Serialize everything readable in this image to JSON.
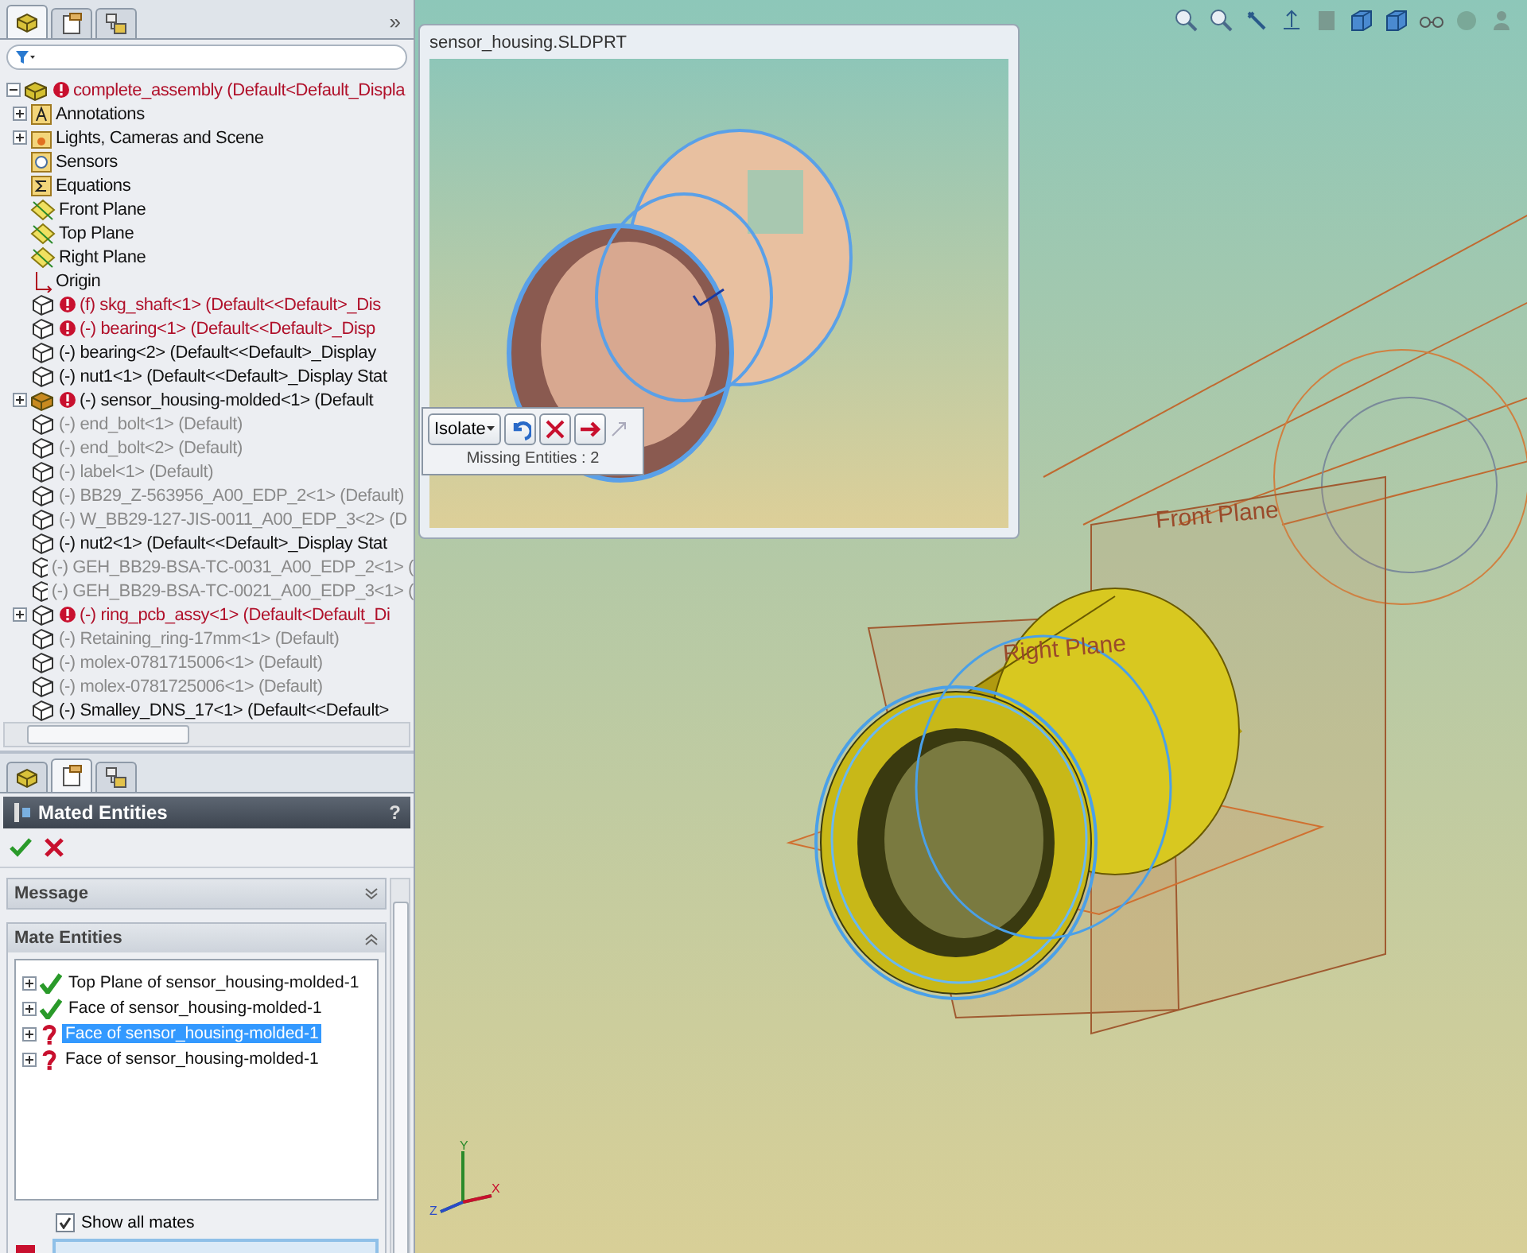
{
  "feature_manager": {
    "tabs": [
      {
        "kind": "tree",
        "selected": true
      },
      {
        "kind": "property",
        "selected": false
      },
      {
        "kind": "config",
        "selected": false
      }
    ],
    "collapse_glyph": "»",
    "tree": {
      "label": "complete_assembly  (Default<Default_Displa",
      "kind": "assembly",
      "failed": true,
      "suppressed": false,
      "error_mark": true,
      "expanded": true,
      "children": [
        {
          "label": "Annotations",
          "kind": "annotations",
          "failed": false,
          "suppressed": false,
          "error_mark": false,
          "expanded": false
        },
        {
          "label": "Lights, Cameras and Scene",
          "kind": "lights",
          "failed": false,
          "suppressed": false,
          "error_mark": false,
          "expanded": false
        },
        {
          "label": "Sensors",
          "kind": "sensors",
          "failed": false,
          "suppressed": false,
          "error_mark": false
        },
        {
          "label": "Equations",
          "kind": "equations",
          "failed": false,
          "suppressed": false,
          "error_mark": false
        },
        {
          "label": "Front Plane",
          "kind": "plane",
          "failed": false,
          "suppressed": false,
          "error_mark": false
        },
        {
          "label": "Top Plane",
          "kind": "plane",
          "failed": false,
          "suppressed": false,
          "error_mark": false
        },
        {
          "label": "Right Plane",
          "kind": "plane",
          "failed": false,
          "suppressed": false,
          "error_mark": false
        },
        {
          "label": "Origin",
          "kind": "origin",
          "failed": false,
          "suppressed": false,
          "error_mark": false
        },
        {
          "label": "(f) skg_shaft<1> (Default<<Default>_Dis",
          "kind": "part",
          "failed": true,
          "suppressed": false,
          "error_mark": true
        },
        {
          "label": "(-) bearing<1> (Default<<Default>_Disp",
          "kind": "part",
          "failed": true,
          "suppressed": false,
          "error_mark": true
        },
        {
          "label": "(-) bearing<2> (Default<<Default>_Display",
          "kind": "part",
          "failed": false,
          "suppressed": false,
          "error_mark": false
        },
        {
          "label": "(-) nut1<1> (Default<<Default>_Display Stat",
          "kind": "part",
          "failed": false,
          "suppressed": false,
          "error_mark": false
        },
        {
          "label": "(-) sensor_housing-molded<1> (Default",
          "kind": "subassembly",
          "failed": false,
          "suppressed": false,
          "error_mark": true,
          "expanded": false
        },
        {
          "label": "(-) end_bolt<1> (Default)",
          "kind": "part",
          "failed": false,
          "suppressed": true,
          "error_mark": false
        },
        {
          "label": "(-) end_bolt<2> (Default)",
          "kind": "part",
          "failed": false,
          "suppressed": true,
          "error_mark": false
        },
        {
          "label": "(-) label<1> (Default)",
          "kind": "part",
          "failed": false,
          "suppressed": true,
          "error_mark": false
        },
        {
          "label": "(-) BB29_Z-563956_A00_EDP_2<1> (Default)",
          "kind": "part",
          "failed": false,
          "suppressed": true,
          "error_mark": false
        },
        {
          "label": "(-) W_BB29-127-JIS-0011_A00_EDP_3<2> (D",
          "kind": "part",
          "failed": false,
          "suppressed": true,
          "error_mark": false
        },
        {
          "label": "(-) nut2<1> (Default<<Default>_Display Stat",
          "kind": "part",
          "failed": false,
          "suppressed": false,
          "error_mark": false
        },
        {
          "label": "(-) GEH_BB29-BSA-TC-0031_A00_EDP_2<1> (",
          "kind": "part",
          "failed": false,
          "suppressed": true,
          "error_mark": false
        },
        {
          "label": "(-) GEH_BB29-BSA-TC-0021_A00_EDP_3<1> (",
          "kind": "part",
          "failed": false,
          "suppressed": true,
          "error_mark": false
        },
        {
          "label": "(-) ring_pcb_assy<1> (Default<Default_Di",
          "kind": "part",
          "failed": true,
          "suppressed": false,
          "error_mark": true,
          "expanded": false
        },
        {
          "label": "(-) Retaining_ring-17mm<1> (Default)",
          "kind": "part",
          "failed": false,
          "suppressed": true,
          "error_mark": false
        },
        {
          "label": "(-) molex-0781715006<1> (Default)",
          "kind": "part",
          "failed": false,
          "suppressed": true,
          "error_mark": false
        },
        {
          "label": "(-) molex-0781725006<1> (Default)",
          "kind": "part",
          "failed": false,
          "suppressed": true,
          "error_mark": false
        },
        {
          "label": "(-) Smalley_DNS_17<1> (Default<<Default>",
          "kind": "part",
          "failed": false,
          "suppressed": false,
          "error_mark": false
        }
      ]
    }
  },
  "property_manager": {
    "tabs": [
      {
        "kind": "tree",
        "selected": false
      },
      {
        "kind": "property",
        "selected": true
      },
      {
        "kind": "config",
        "selected": false
      }
    ],
    "title": "Mated Entities",
    "help": "?",
    "sections": [
      {
        "title": "Message",
        "expanded": false
      },
      {
        "title": "Mate Entities",
        "expanded": true,
        "items": [
          {
            "label": "Top Plane of sensor_housing-molded-1",
            "kind": "ok",
            "selected": false
          },
          {
            "label": "Face of sensor_housing-molded-1",
            "kind": "ok",
            "selected": false
          },
          {
            "label": "Face of sensor_housing-molded-1",
            "kind": "missing",
            "selected": true
          },
          {
            "label": "Face of sensor_housing-molded-1",
            "kind": "missing",
            "selected": false
          }
        ]
      }
    ],
    "show_all_mates": {
      "label": "Show all mates",
      "checked": true
    }
  },
  "preview": {
    "title": "sensor_housing.SLDPRT"
  },
  "isolate_bar": {
    "button": "Isolate",
    "status": "Missing Entities :  2"
  },
  "viewport": {
    "plane_labels": [
      {
        "text": "Front Plane",
        "kind": "front"
      },
      {
        "text": "Right Plane",
        "kind": "right"
      }
    ],
    "triad_axes": [
      "Y",
      "X",
      "Z"
    ]
  }
}
